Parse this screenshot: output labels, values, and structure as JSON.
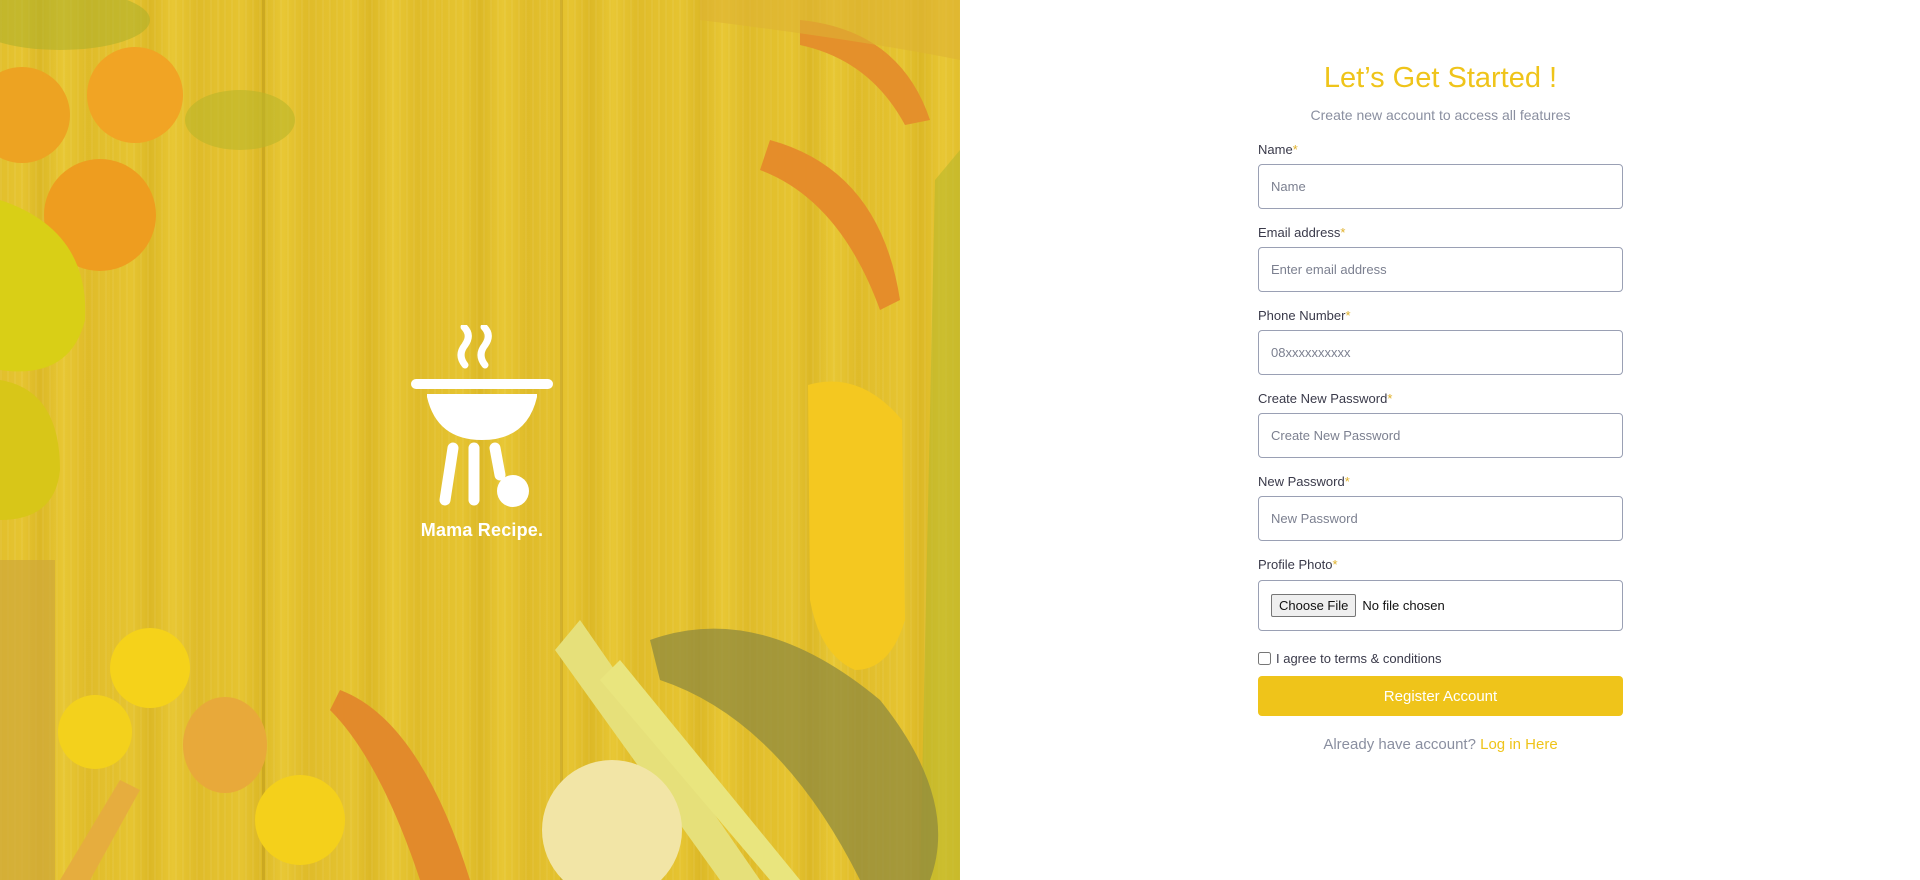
{
  "brand": {
    "name": "Mama Recipe."
  },
  "form": {
    "title": "Let’s Get Started !",
    "subtitle": "Create new account to access all features",
    "required_mark": "*",
    "fields": [
      {
        "label": "Name",
        "placeholder": "Name",
        "value": ""
      },
      {
        "label": "Email address",
        "placeholder": "Enter email address",
        "value": ""
      },
      {
        "label": "Phone Number",
        "placeholder": "08xxxxxxxxxx",
        "value": ""
      },
      {
        "label": "Create New Password",
        "placeholder": "Create New Password",
        "value": ""
      },
      {
        "label": "New Password",
        "placeholder": "New Password",
        "value": ""
      }
    ],
    "photo": {
      "label": "Profile Photo",
      "button_label": "Choose File",
      "status": "No file chosen"
    },
    "terms": {
      "label": "I agree to terms & conditions",
      "checked": false
    },
    "submit_label": "Register Account",
    "login_prompt": "Already have account?",
    "login_link": "Log in Here"
  },
  "icons": {
    "logo": "grill-icon"
  },
  "colors": {
    "accent": "#efc41a",
    "hero_overlay": "#e2bf2c",
    "muted_text": "#8a8fa0"
  }
}
